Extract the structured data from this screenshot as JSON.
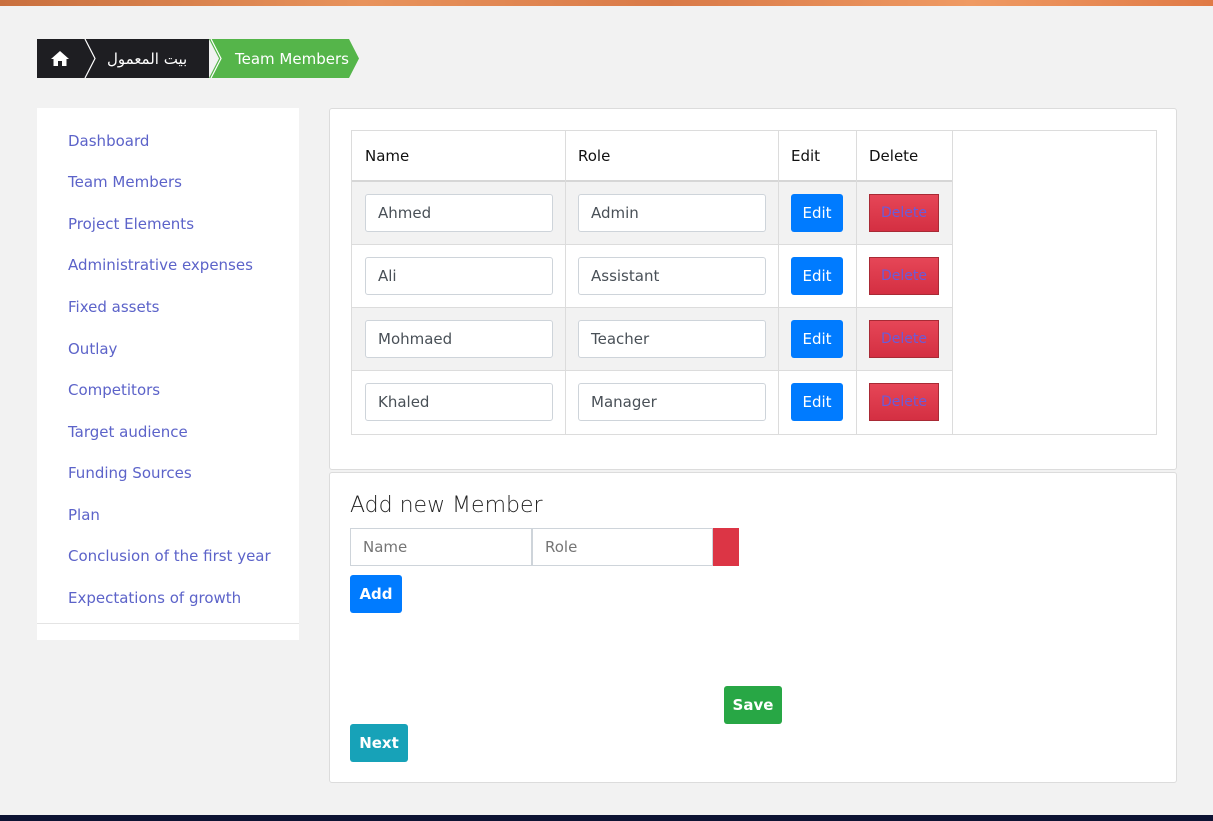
{
  "breadcrumb": {
    "home_icon": "home-icon",
    "items": [
      "بيت المعمول",
      "Team Members"
    ]
  },
  "sidebar": {
    "items": [
      {
        "label": "Dashboard"
      },
      {
        "label": "Team Members"
      },
      {
        "label": "Project Elements"
      },
      {
        "label": "Administrative expenses"
      },
      {
        "label": "Fixed assets"
      },
      {
        "label": "Outlay"
      },
      {
        "label": "Competitors"
      },
      {
        "label": "Target audience"
      },
      {
        "label": "Funding Sources"
      },
      {
        "label": "Plan"
      },
      {
        "label": "Conclusion of the first year"
      },
      {
        "label": "Expectations of growth"
      }
    ]
  },
  "table": {
    "headers": [
      "Name",
      "Role",
      "Edit",
      "Delete"
    ],
    "rows": [
      {
        "name": "Ahmed",
        "role": "Admin",
        "edit": "Edit",
        "delete": "Delete"
      },
      {
        "name": "Ali",
        "role": "Assistant",
        "edit": "Edit",
        "delete": "Delete"
      },
      {
        "name": "Mohmaed",
        "role": "Teacher",
        "edit": "Edit",
        "delete": "Delete"
      },
      {
        "name": "Khaled",
        "role": "Manager",
        "edit": "Edit",
        "delete": "Delete"
      }
    ]
  },
  "add_member": {
    "title": "Add new Member",
    "name_placeholder": "Name",
    "role_placeholder": "Role",
    "add_label": "Add"
  },
  "actions": {
    "save_label": "Save",
    "next_label": "Next"
  },
  "colors": {
    "accent_green": "#55b54a",
    "primary": "#007bff",
    "danger": "#dc3545",
    "success": "#28a745",
    "info": "#17a2b8",
    "link": "#5c63c9"
  }
}
